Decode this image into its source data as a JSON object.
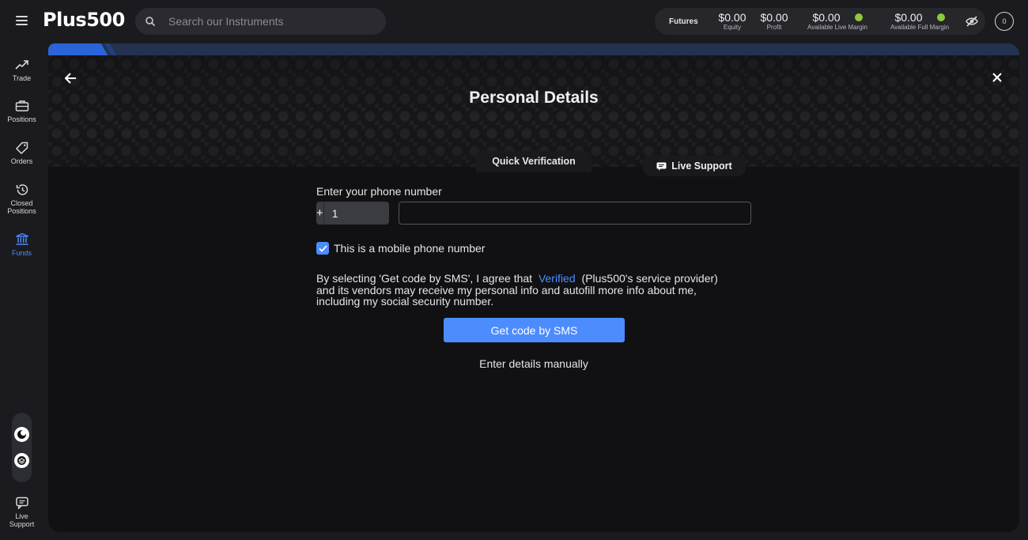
{
  "brand": {
    "logo_left": "Plus",
    "logo_right": "500"
  },
  "search": {
    "placeholder": "Search our Instruments"
  },
  "account": {
    "futures_label": "Futures",
    "equity": {
      "value": "$0.00",
      "label": "Equity"
    },
    "profit": {
      "value": "$0.00",
      "label": "Profit"
    },
    "live_margin": {
      "value": "$0.00",
      "label": "Available Live Margin"
    },
    "full_margin": {
      "value": "$0.00",
      "label": "Available Full Margin"
    },
    "avatar_initial": "0"
  },
  "sidebar": {
    "items": [
      {
        "label": "Trade",
        "icon": "trend-icon"
      },
      {
        "label": "Positions",
        "icon": "briefcase-icon"
      },
      {
        "label": "Orders",
        "icon": "tag-icon"
      },
      {
        "label": "Closed Positions",
        "icon": "history-icon"
      },
      {
        "label": "Funds",
        "icon": "bank-icon"
      },
      {
        "label": "Live Support",
        "icon": "chat-icon"
      }
    ]
  },
  "page": {
    "title": "Personal Details",
    "tab_label": "Quick Verification",
    "live_support_label": "Live Support"
  },
  "form": {
    "phone_label": "Enter your phone number",
    "country_code": "1",
    "phone_value": "",
    "mobile_checkbox_label": "This is a mobile phone number",
    "consent_before": "By selecting 'Get code by SMS', I agree that",
    "consent_link": "Verified",
    "consent_after": "(Plus500's service provider) and its vendors may receive my personal info and autofill more info about me, including my social security number.",
    "sms_button": "Get code by SMS",
    "manual_link": "Enter details manually"
  },
  "colors": {
    "accent": "#4d8cff",
    "ok": "#8fc93a",
    "panel": "#111113",
    "background": "#1b1b1f"
  }
}
